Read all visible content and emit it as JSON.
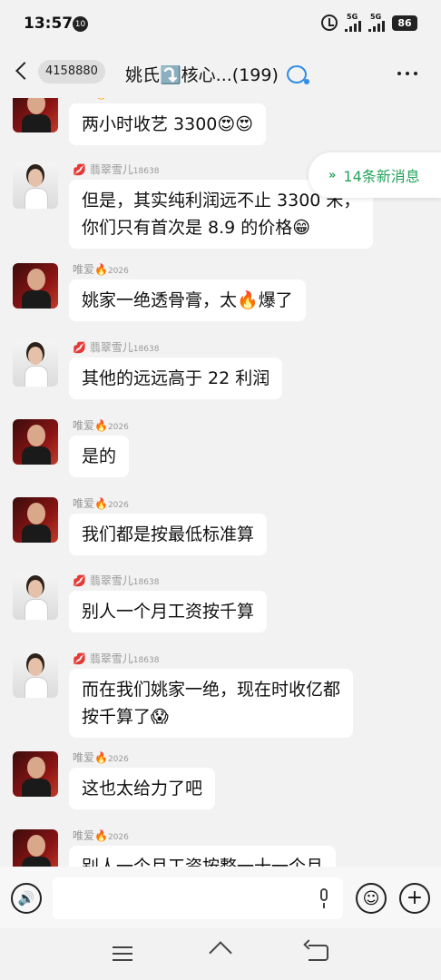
{
  "status_bar": {
    "time": "13:57",
    "notification_badge": "10",
    "signal_1_label": "5G",
    "signal_2_label": "5G",
    "battery": "86"
  },
  "header": {
    "unread_count": "4158880",
    "group_title": "姚氏⤵️核心...(199)"
  },
  "new_messages": {
    "arrow": "»",
    "label": "14条新消息"
  },
  "senders": {
    "weiai": {
      "name": "唯爱🔥",
      "tag": "2026"
    },
    "feicui": {
      "name": "翡翠雪儿",
      "tag": "18638",
      "icon": "💋"
    }
  },
  "messages": [
    {
      "sender_key": "weiai",
      "name": "唯爱🔥",
      "tag": "2026",
      "avatar": "man",
      "lines": [
        "两小时收艺 3300😍😍"
      ]
    },
    {
      "sender_key": "feicui",
      "name": "翡翠雪儿",
      "tag": "18638",
      "avatar": "woman",
      "lines": [
        "但是，其实纯利润远不止 3300 米，",
        "你们只有首次是 8.9 的价格😁"
      ]
    },
    {
      "sender_key": "weiai",
      "name": "唯爱🔥",
      "tag": "2026",
      "avatar": "man",
      "lines": [
        "姚家一绝透骨膏，太🔥爆了"
      ]
    },
    {
      "sender_key": "feicui",
      "name": "翡翠雪儿",
      "tag": "18638",
      "avatar": "woman",
      "lines": [
        "其他的远远高于 22 利润"
      ]
    },
    {
      "sender_key": "weiai",
      "name": "唯爱🔥",
      "tag": "2026",
      "avatar": "man",
      "lines": [
        "是的"
      ]
    },
    {
      "sender_key": "weiai",
      "name": "唯爱🔥",
      "tag": "2026",
      "avatar": "man",
      "lines": [
        "我们都是按最低标准算"
      ]
    },
    {
      "sender_key": "feicui",
      "name": "翡翠雪儿",
      "tag": "18638",
      "avatar": "woman",
      "lines": [
        "别人一个月工资按千算"
      ]
    },
    {
      "sender_key": "feicui",
      "name": "翡翠雪儿",
      "tag": "18638",
      "avatar": "woman",
      "lines": [
        "而在我们姚家一绝，现在时收亿都",
        "按千算了😱"
      ]
    },
    {
      "sender_key": "weiai",
      "name": "唯爱🔥",
      "tag": "2026",
      "avatar": "man",
      "lines": [
        "这也太给力了吧"
      ]
    },
    {
      "sender_key": "weiai",
      "name": "唯爱🔥",
      "tag": "2026",
      "avatar": "man",
      "lines": [
        "别人一个月工资按整一十一个月"
      ]
    }
  ],
  "input": {
    "placeholder": "",
    "voice_icon": "🔊",
    "emoji_icon": "☺",
    "plus_icon": "+"
  }
}
